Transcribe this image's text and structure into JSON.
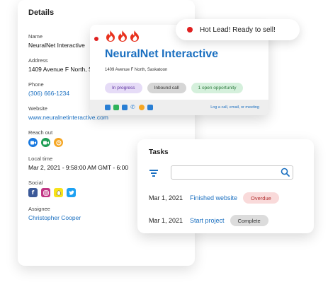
{
  "toast": {
    "text": "Hot Lead! Ready to sell!"
  },
  "details": {
    "title": "Details",
    "name_label": "Name",
    "name_value": "NeuralNet Interactive",
    "address_label": "Address",
    "address_value": "1409 Avenue F North, S",
    "phone_label": "Phone",
    "phone_value": "(306) 666-1234",
    "website_label": "Website",
    "website_value": "www.neuralnetinteractive.com",
    "reach_label": "Reach out",
    "reach_icons": [
      "video-icon",
      "meet-icon",
      "clock-app-icon"
    ],
    "localtime_label": "Local time",
    "localtime_value": "Mar 2, 2021 - 9:58:00 AM GMT - 6:00",
    "social_label": "Social",
    "social_icons": [
      "facebook-icon",
      "instagram-icon",
      "snapchat-icon",
      "twitter-icon"
    ],
    "assignee_label": "Assignee",
    "assignee_value": "Christopher Cooper"
  },
  "company": {
    "name": "NeuralNet Interactive",
    "address": "1409 Avenue F North, Saskatoon",
    "chips": [
      "In progress",
      "Inbound call",
      "1 open opportunity"
    ],
    "toolbar_icons": [
      "document-icon",
      "email-icon",
      "contact-card-icon",
      "phone-icon",
      "clock-icon",
      "calendar-icon"
    ],
    "log_link": "Log a call, email, or meeting"
  },
  "tasks": {
    "title": "Tasks",
    "search_placeholder": "",
    "rows": [
      {
        "date": "Mar 1, 2021",
        "task": "Finished website",
        "status": "Overdue"
      },
      {
        "date": "Mar 1, 2021",
        "task": "Start project",
        "status": "Complete"
      }
    ]
  },
  "colors": {
    "accent": "#1a6fc0",
    "hot": "#e02020",
    "flame": "#e8301c"
  }
}
